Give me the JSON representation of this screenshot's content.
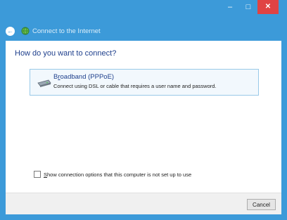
{
  "window": {
    "controls": {
      "minimize": "–",
      "maximize": "□",
      "close": "✕"
    }
  },
  "nav": {
    "back_icon": "back-arrow-icon",
    "title": "Connect to the Internet"
  },
  "main": {
    "heading": "How do you want to connect?",
    "option": {
      "icon": "broadband-modem-icon",
      "title_prefix": "B",
      "title_access_key": "r",
      "title_rest": "oadband (PPPoE)",
      "description": "Connect using DSL or cable that requires a user name and password."
    },
    "show_options": {
      "checked": false,
      "label_access_key": "S",
      "label_rest": "how connection options that this computer is not set up to use"
    }
  },
  "footer": {
    "cancel_label": "Cancel"
  },
  "colors": {
    "frame": "#3c9ad9",
    "close": "#e04343",
    "link": "#1e3f8c"
  }
}
